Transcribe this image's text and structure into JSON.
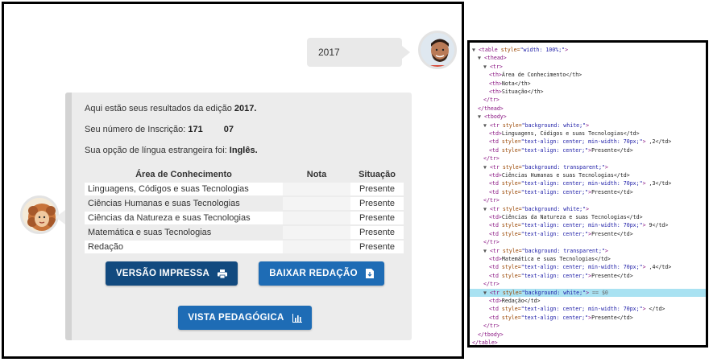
{
  "chat": {
    "user_message": "2017",
    "bot": {
      "line1_prefix": "Aqui estão seus resultados da edição ",
      "line1_year": "2017.",
      "line2_prefix": "Seu número de Inscrição: ",
      "line2_num_start": "171",
      "line2_num_end": "07",
      "line3_prefix": "Sua opção de língua estrangeira foi: ",
      "line3_lang": "Inglês."
    },
    "table": {
      "headers": [
        "Área de Conhecimento",
        "Nota",
        "Situação"
      ],
      "rows": [
        {
          "area": "Linguagens, Códigos e suas Tecnologias",
          "nota": "",
          "situacao": "Presente"
        },
        {
          "area": "Ciências Humanas e suas Tecnologias",
          "nota": "",
          "situacao": "Presente"
        },
        {
          "area": "Ciências da Natureza e suas Tecnologias",
          "nota": "",
          "situacao": "Presente"
        },
        {
          "area": "Matemática e suas Tecnologias",
          "nota": "",
          "situacao": "Presente"
        },
        {
          "area": "Redação",
          "nota": "",
          "situacao": "Presente"
        }
      ]
    },
    "buttons": {
      "print": "VERSÃO IMPRESSA",
      "download": "BAIXAR REDAÇÃO",
      "pedagogical": "VISTA PEDAGÓGICA"
    },
    "icons": [
      "printer-icon",
      "file-download-icon",
      "bar-chart-icon"
    ]
  },
  "devtools": {
    "lines": [
      {
        "tri": "▼",
        "a": "<table ",
        "b": "style=",
        "c": "\"width: 100%;\"",
        "d": ">",
        "e": ""
      },
      {
        "tri": "▼",
        "a": "<thead>",
        "b": "",
        "c": "",
        "d": "",
        "e": ""
      },
      {
        "tri": "▼",
        "a": "<tr>",
        "b": "",
        "c": "",
        "d": "",
        "e": ""
      },
      {
        "tri": "",
        "a": "<th>",
        "b": "",
        "c": "",
        "d": "",
        "e": "Área de Conhecimento</th>"
      },
      {
        "tri": "",
        "a": "<th>",
        "b": "",
        "c": "",
        "d": "",
        "e": "Nota</th>"
      },
      {
        "tri": "",
        "a": "<th>",
        "b": "",
        "c": "",
        "d": "",
        "e": "Situação</th>"
      },
      {
        "tri": "",
        "a": "</tr>",
        "b": "",
        "c": "",
        "d": "",
        "e": ""
      },
      {
        "tri": "",
        "a": "</thead>",
        "b": "",
        "c": "",
        "d": "",
        "e": ""
      },
      {
        "tri": "▼",
        "a": "<tbody>",
        "b": "",
        "c": "",
        "d": "",
        "e": ""
      },
      {
        "tri": "▼",
        "a": "<tr ",
        "b": "style=",
        "c": "\"background: white;\"",
        "d": ">",
        "e": ""
      },
      {
        "tri": "",
        "a": "<td>",
        "b": "",
        "c": "",
        "d": "",
        "e": "Linguagens, Códigos e suas Tecnologias</td>"
      },
      {
        "tri": "",
        "a": "<td ",
        "b": "style=",
        "c": "\"text-align: center; min-width: 70px;\"",
        "d": ">",
        "e": " ,2</td>"
      },
      {
        "tri": "",
        "a": "<td ",
        "b": "style=",
        "c": "\"text-align: center;\"",
        "d": ">",
        "e": "Presente</td>"
      },
      {
        "tri": "",
        "a": "</tr>",
        "b": "",
        "c": "",
        "d": "",
        "e": ""
      },
      {
        "tri": "▼",
        "a": "<tr ",
        "b": "style=",
        "c": "\"background: transparent;\"",
        "d": ">",
        "e": ""
      },
      {
        "tri": "",
        "a": "<td>",
        "b": "",
        "c": "",
        "d": "",
        "e": "Ciências Humanas e suas Tecnologias</td>"
      },
      {
        "tri": "",
        "a": "<td ",
        "b": "style=",
        "c": "\"text-align: center; min-width: 70px;\"",
        "d": ">",
        "e": " ,3</td>"
      },
      {
        "tri": "",
        "a": "<td ",
        "b": "style=",
        "c": "\"text-align: center;\"",
        "d": ">",
        "e": "Presente</td>"
      },
      {
        "tri": "",
        "a": "</tr>",
        "b": "",
        "c": "",
        "d": "",
        "e": ""
      },
      {
        "tri": "▼",
        "a": "<tr ",
        "b": "style=",
        "c": "\"background: white;\"",
        "d": ">",
        "e": ""
      },
      {
        "tri": "",
        "a": "<td>",
        "b": "",
        "c": "",
        "d": "",
        "e": "Ciências da Natureza e suas Tecnologias</td>"
      },
      {
        "tri": "",
        "a": "<td ",
        "b": "style=",
        "c": "\"text-align: center; min-width: 70px;\"",
        "d": ">",
        "e": "  9</td>"
      },
      {
        "tri": "",
        "a": "<td ",
        "b": "style=",
        "c": "\"text-align: center;\"",
        "d": ">",
        "e": "Presente</td>"
      },
      {
        "tri": "",
        "a": "</tr>",
        "b": "",
        "c": "",
        "d": "",
        "e": ""
      },
      {
        "tri": "▼",
        "a": "<tr ",
        "b": "style=",
        "c": "\"background: transparent;\"",
        "d": ">",
        "e": ""
      },
      {
        "tri": "",
        "a": "<td>",
        "b": "",
        "c": "",
        "d": "",
        "e": "Matemática e suas Tecnologias</td>"
      },
      {
        "tri": "",
        "a": "<td ",
        "b": "style=",
        "c": "\"text-align: center; min-width: 70px;\"",
        "d": ">",
        "e": " ,4</td>"
      },
      {
        "tri": "",
        "a": "<td ",
        "b": "style=",
        "c": "\"text-align: center;\"",
        "d": ">",
        "e": "Presente</td>"
      },
      {
        "tri": "",
        "a": "</tr>",
        "b": "",
        "c": "",
        "d": "",
        "e": ""
      },
      {
        "tri": "▼",
        "a": "<tr ",
        "b": "style=",
        "c": "\"background: white;\"",
        "d": ">",
        "e": " == $0"
      },
      {
        "tri": "",
        "a": "<td>",
        "b": "",
        "c": "",
        "d": "",
        "e": "Redação</td>"
      },
      {
        "tri": "",
        "a": "<td ",
        "b": "style=",
        "c": "\"text-align: center; min-width: 70px;\"",
        "d": ">",
        "e": "  </td>"
      },
      {
        "tri": "",
        "a": "<td ",
        "b": "style=",
        "c": "\"text-align: center;\"",
        "d": ">",
        "e": "Presente</td>"
      },
      {
        "tri": "",
        "a": "</tr>",
        "b": "",
        "c": "",
        "d": "",
        "e": ""
      },
      {
        "tri": "",
        "a": "</tbody>",
        "b": "",
        "c": "",
        "d": "",
        "e": ""
      },
      {
        "tri": "",
        "a": "</table>",
        "b": "",
        "c": "",
        "d": "",
        "e": ""
      }
    ],
    "highlighted_line": 29
  }
}
